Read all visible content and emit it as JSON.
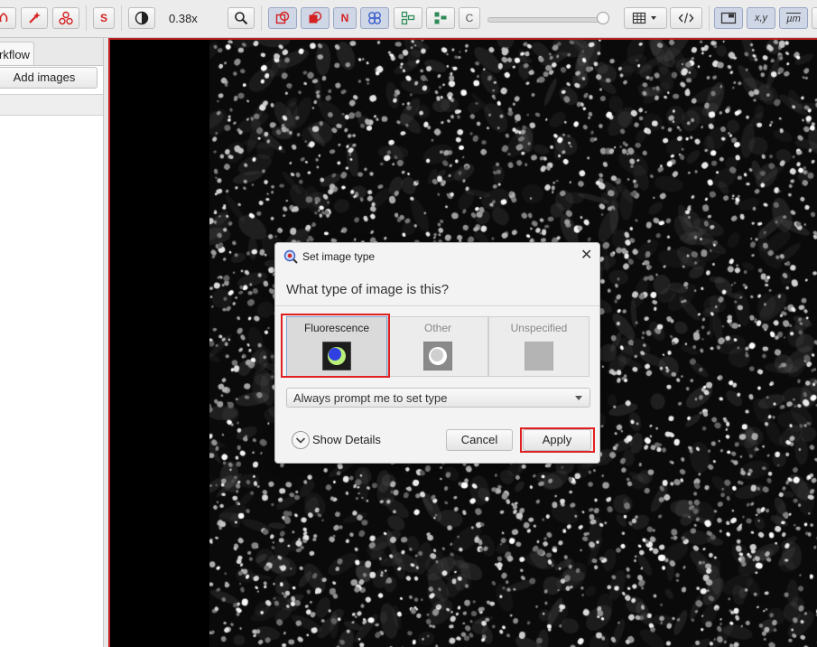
{
  "toolbar": {
    "zoom_level": "0.38x",
    "letters": {
      "s": "S",
      "n": "N",
      "c": "C"
    },
    "coords_label": "x,y",
    "micron_label": "µm",
    "icons": [
      "brush-icon",
      "wand-icon",
      "points-icon",
      "s-letter",
      "contrast-icon",
      "zoom-icon",
      "overlay-icon",
      "fill-icon",
      "n-letter",
      "pixel-classifier-icon",
      "tiles-icon",
      "grid-icon",
      "c-letter",
      "table-icon",
      "script-icon",
      "selection-icon",
      "coords-icon",
      "scalebar-icon"
    ],
    "colors": {
      "accent_red": "#d42020",
      "accent_green": "#2e8b57"
    }
  },
  "left_panel": {
    "tab_label": "rkflow",
    "add_images_label": "Add images"
  },
  "dialog": {
    "title": "Set image type",
    "question": "What type of image is this?",
    "options": [
      {
        "label": "Fluorescence",
        "selected": true
      },
      {
        "label": "Other",
        "selected": false
      },
      {
        "label": "Unspecified",
        "selected": false
      }
    ],
    "prompt_select": "Always prompt me to set type",
    "show_details": "Show Details",
    "cancel": "Cancel",
    "apply": "Apply"
  }
}
